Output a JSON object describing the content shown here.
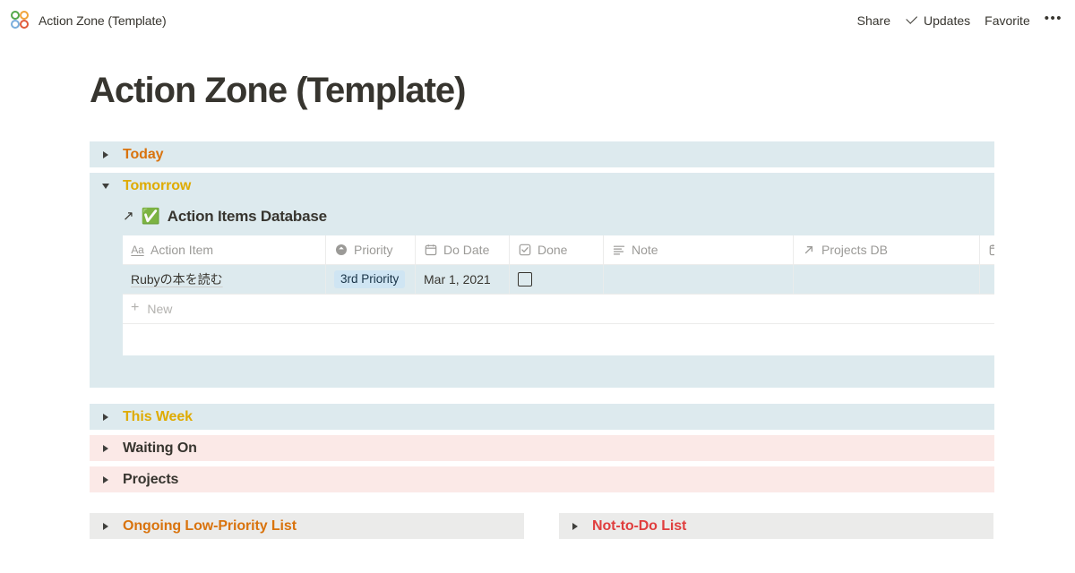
{
  "topbar": {
    "page_icon_name": "four-circles-icon",
    "breadcrumb_title": "Action Zone (Template)",
    "share_label": "Share",
    "updates_label": "Updates",
    "favorite_label": "Favorite",
    "more_label": "•••"
  },
  "page": {
    "title": "Action Zone (Template)"
  },
  "blocks": [
    {
      "label": "Today",
      "state": "collapsed",
      "bg": "#ddeaee",
      "color": "#d9730d"
    },
    {
      "label": "Tomorrow",
      "state": "expanded",
      "bg": "#ddeaee",
      "color": "#dfab01"
    },
    {
      "label": "This Week",
      "state": "collapsed",
      "bg": "#ddeaee",
      "color": "#dfab01"
    },
    {
      "label": "Waiting On",
      "state": "collapsed",
      "bg": "#fbe9e7",
      "color": "#37352f"
    },
    {
      "label": "Projects",
      "state": "collapsed",
      "bg": "#fbe9e7",
      "color": "#37352f"
    }
  ],
  "bottom_blocks": [
    {
      "label": "Ongoing Low-Priority List",
      "state": "collapsed",
      "bg": "#ebebea",
      "color": "#d9730d"
    },
    {
      "label": "Not-to-Do List",
      "state": "collapsed",
      "bg": "#ebebea",
      "color": "#e03e3e"
    }
  ],
  "database": {
    "link_arrow": "↗",
    "emoji": "✅",
    "title": "Action Items Database",
    "columns": [
      {
        "name": "Action Item",
        "icon": "text-aa-icon"
      },
      {
        "name": "Priority",
        "icon": "select-circle-icon"
      },
      {
        "name": "Do Date",
        "icon": "calendar-icon"
      },
      {
        "name": "Done",
        "icon": "checkbox-icon"
      },
      {
        "name": "Note",
        "icon": "text-lines-icon"
      },
      {
        "name": "Projects DB",
        "icon": "relation-arrow-icon"
      },
      {
        "name": "",
        "icon": "calendar-icon"
      }
    ],
    "rows": [
      {
        "action_item": "Rubyの本を読む",
        "priority": "3rd Priority",
        "priority_color": "#cfe5f3",
        "do_date": "Mar 1, 2021",
        "done": false,
        "note": "",
        "projects_db": "",
        "extra": ""
      }
    ],
    "new_row_label": "New",
    "new_row_plus": "+"
  }
}
